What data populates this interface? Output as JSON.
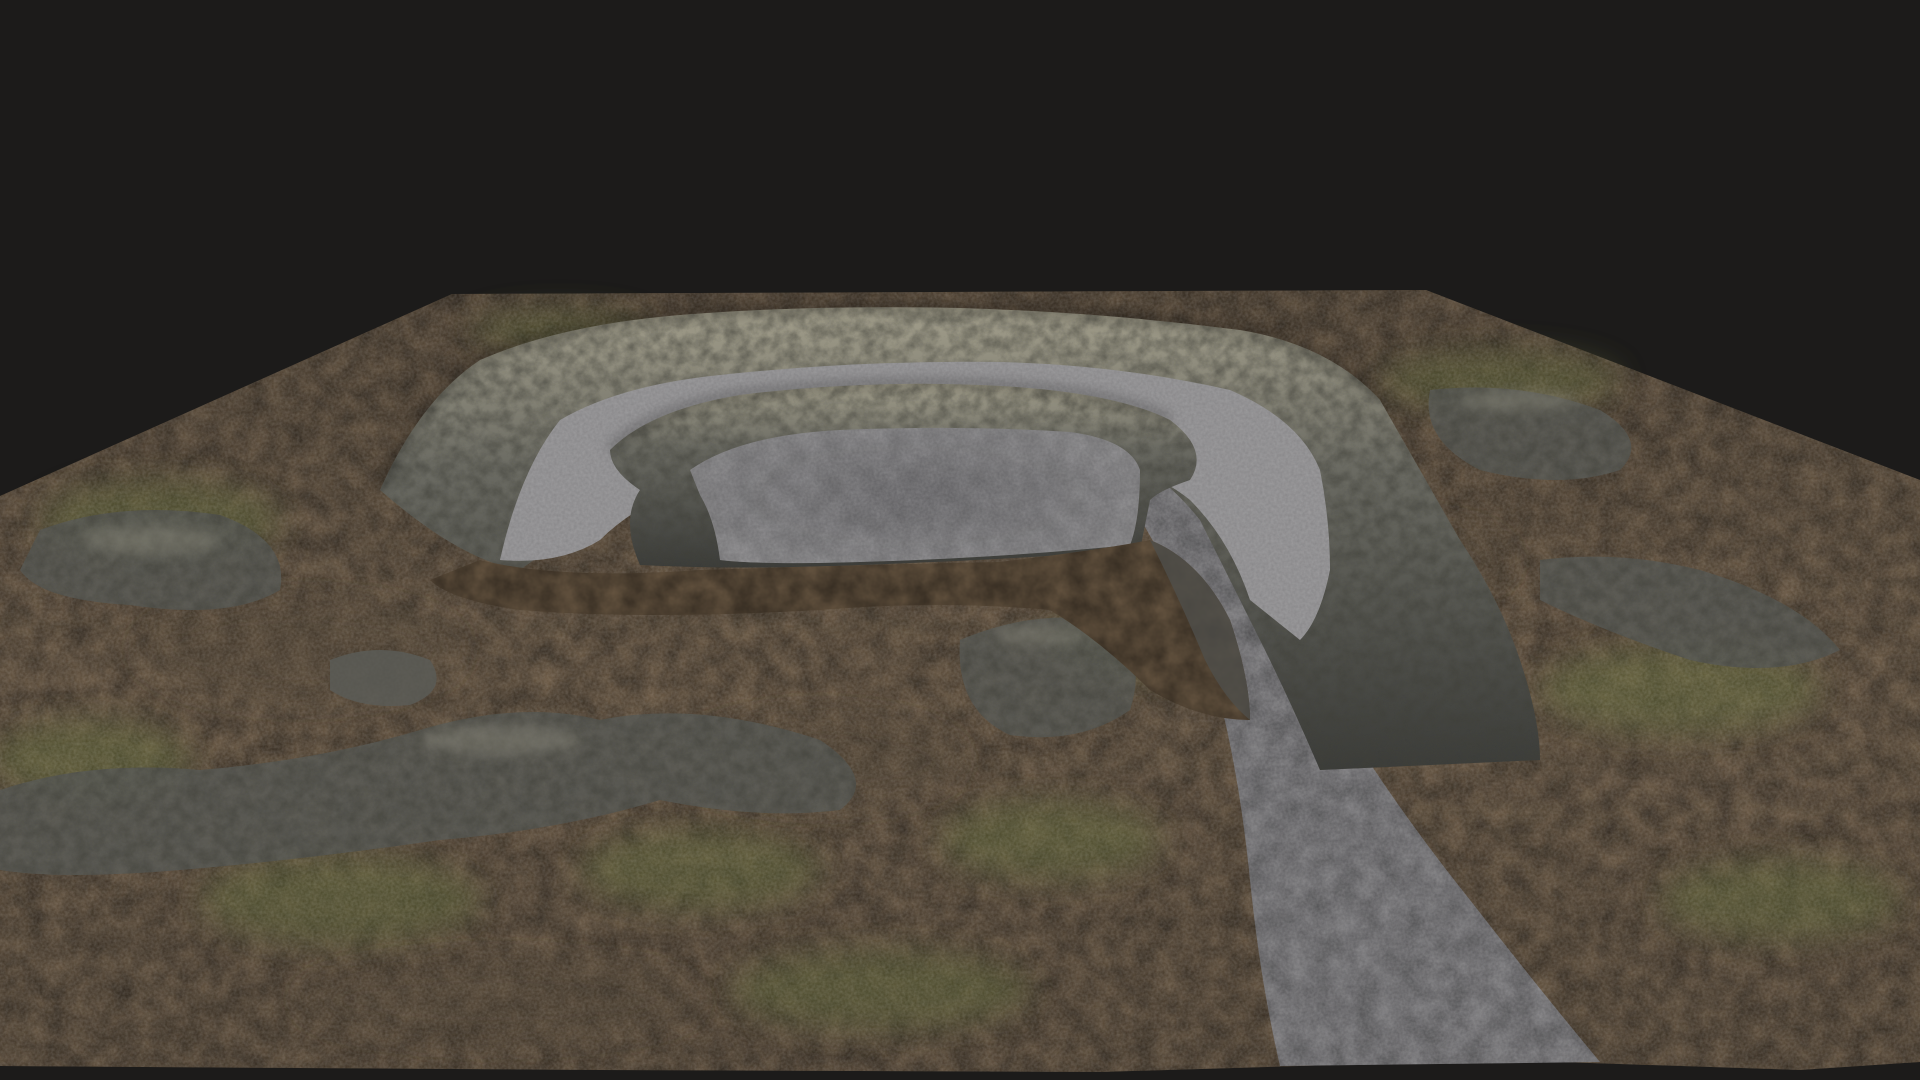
{
  "scene": {
    "background_color": "#1c1b1a",
    "ground_color": "#6d5a44",
    "grass_color": "#5d6434",
    "rock_color": "#5f5f58",
    "gravel_color": "#7d7c7e",
    "rim_highlight_color": "#8d8873"
  }
}
